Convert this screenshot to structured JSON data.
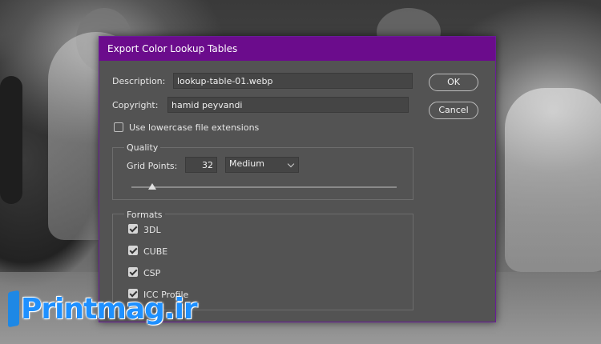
{
  "dialog": {
    "title": "Export Color Lookup Tables",
    "description_label": "Description:",
    "description_value": "lookup-table-01.webp",
    "copyright_label": "Copyright:",
    "copyright_value": "hamid peyvandi",
    "lowercase_label": "Use lowercase file extensions",
    "lowercase_checked": false,
    "ok_label": "OK",
    "cancel_label": "Cancel",
    "quality": {
      "title": "Quality",
      "grid_points_label": "Grid Points:",
      "grid_points_value": "32",
      "preset_value": "Medium",
      "slider_level_fraction": 0.08
    },
    "formats": {
      "title": "Formats",
      "items": [
        {
          "label": "3DL",
          "checked": true
        },
        {
          "label": "CUBE",
          "checked": true
        },
        {
          "label": "CSP",
          "checked": true
        },
        {
          "label": "ICC Profile",
          "checked": true
        }
      ]
    }
  },
  "watermark": {
    "text": "Printmag.ir",
    "color": "#1e90ff"
  },
  "colors": {
    "titlebar": "#6b0c8c",
    "dialog_bg": "#535353"
  }
}
